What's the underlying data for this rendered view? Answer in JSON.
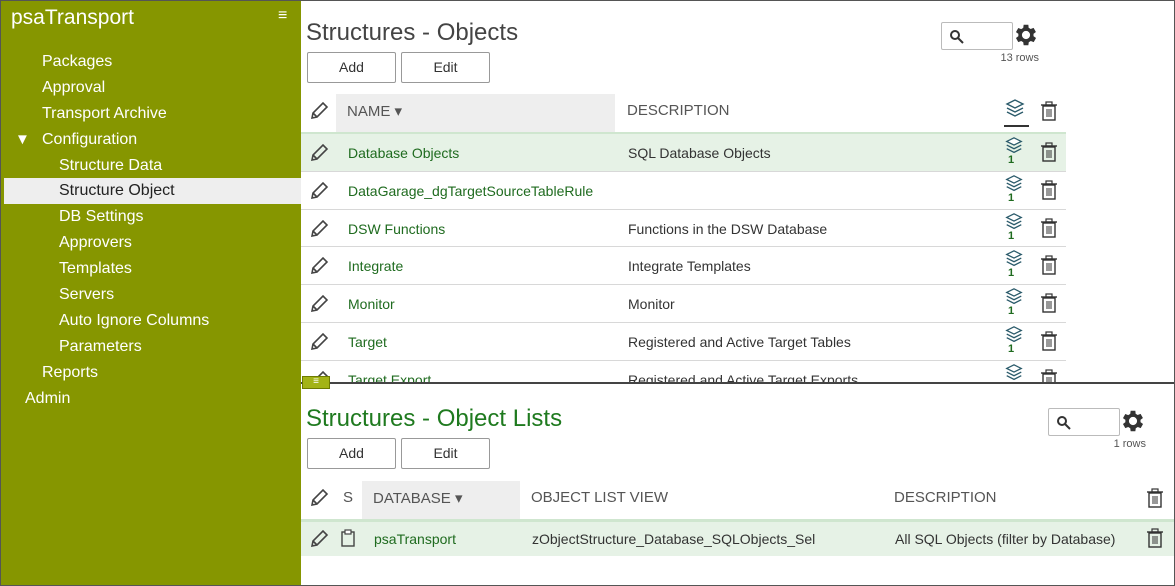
{
  "app": {
    "title": "psaTransport",
    "menu_icon": "hamburger-icon"
  },
  "sidebar": {
    "items": [
      {
        "label": "Packages",
        "level": 1
      },
      {
        "label": "Approval",
        "level": 1
      },
      {
        "label": "Transport Archive",
        "level": 1
      },
      {
        "label": "Configuration",
        "level": 1,
        "expanded": true,
        "toggle": "▼"
      },
      {
        "label": "Structure Data",
        "level": 2
      },
      {
        "label": "Structure Object",
        "level": 2,
        "active": true
      },
      {
        "label": "DB Settings",
        "level": 2
      },
      {
        "label": "Approvers",
        "level": 2
      },
      {
        "label": "Templates",
        "level": 2
      },
      {
        "label": "Servers",
        "level": 2
      },
      {
        "label": "Auto Ignore Columns",
        "level": 2
      },
      {
        "label": "Parameters",
        "level": 2
      },
      {
        "label": "Reports",
        "level": 1
      },
      {
        "label": "Admin",
        "level": 0
      }
    ]
  },
  "objects_panel": {
    "title": "Structures - Objects",
    "add_label": "Add",
    "edit_label": "Edit",
    "rows_label": "13 rows",
    "columns": {
      "name": "NAME ▾",
      "description": "DESCRIPTION"
    },
    "rows": [
      {
        "name": "Database Objects",
        "description": "SQL Database Objects",
        "count": "1"
      },
      {
        "name": "DataGarage_dgTargetSourceTableRule",
        "description": "",
        "count": "1"
      },
      {
        "name": "DSW Functions",
        "description": "Functions in the DSW Database",
        "count": "1"
      },
      {
        "name": "Integrate",
        "description": "Integrate Templates",
        "count": "1"
      },
      {
        "name": "Monitor",
        "description": "Monitor",
        "count": "1"
      },
      {
        "name": "Target",
        "description": "Registered and Active Target Tables",
        "count": "1"
      },
      {
        "name": "Target Export",
        "description": "Registered and Active Target Exports",
        "count": ""
      }
    ]
  },
  "lists_panel": {
    "title": "Structures - Object Lists",
    "add_label": "Add",
    "edit_label": "Edit",
    "rows_label": "1 rows",
    "columns": {
      "s": "S",
      "database": "DATABASE ▾",
      "object_list_view": "OBJECT LIST VIEW",
      "description": "DESCRIPTION"
    },
    "rows": [
      {
        "database": "psaTransport",
        "object_list_view": "zObjectStructure_Database_SQLObjects_Sel",
        "description": "All SQL Objects (filter by Database)"
      }
    ]
  },
  "colors": {
    "sidebar": "#869600",
    "accent_green": "#1f6b1f",
    "row_highlight": "#e6f2e6"
  }
}
